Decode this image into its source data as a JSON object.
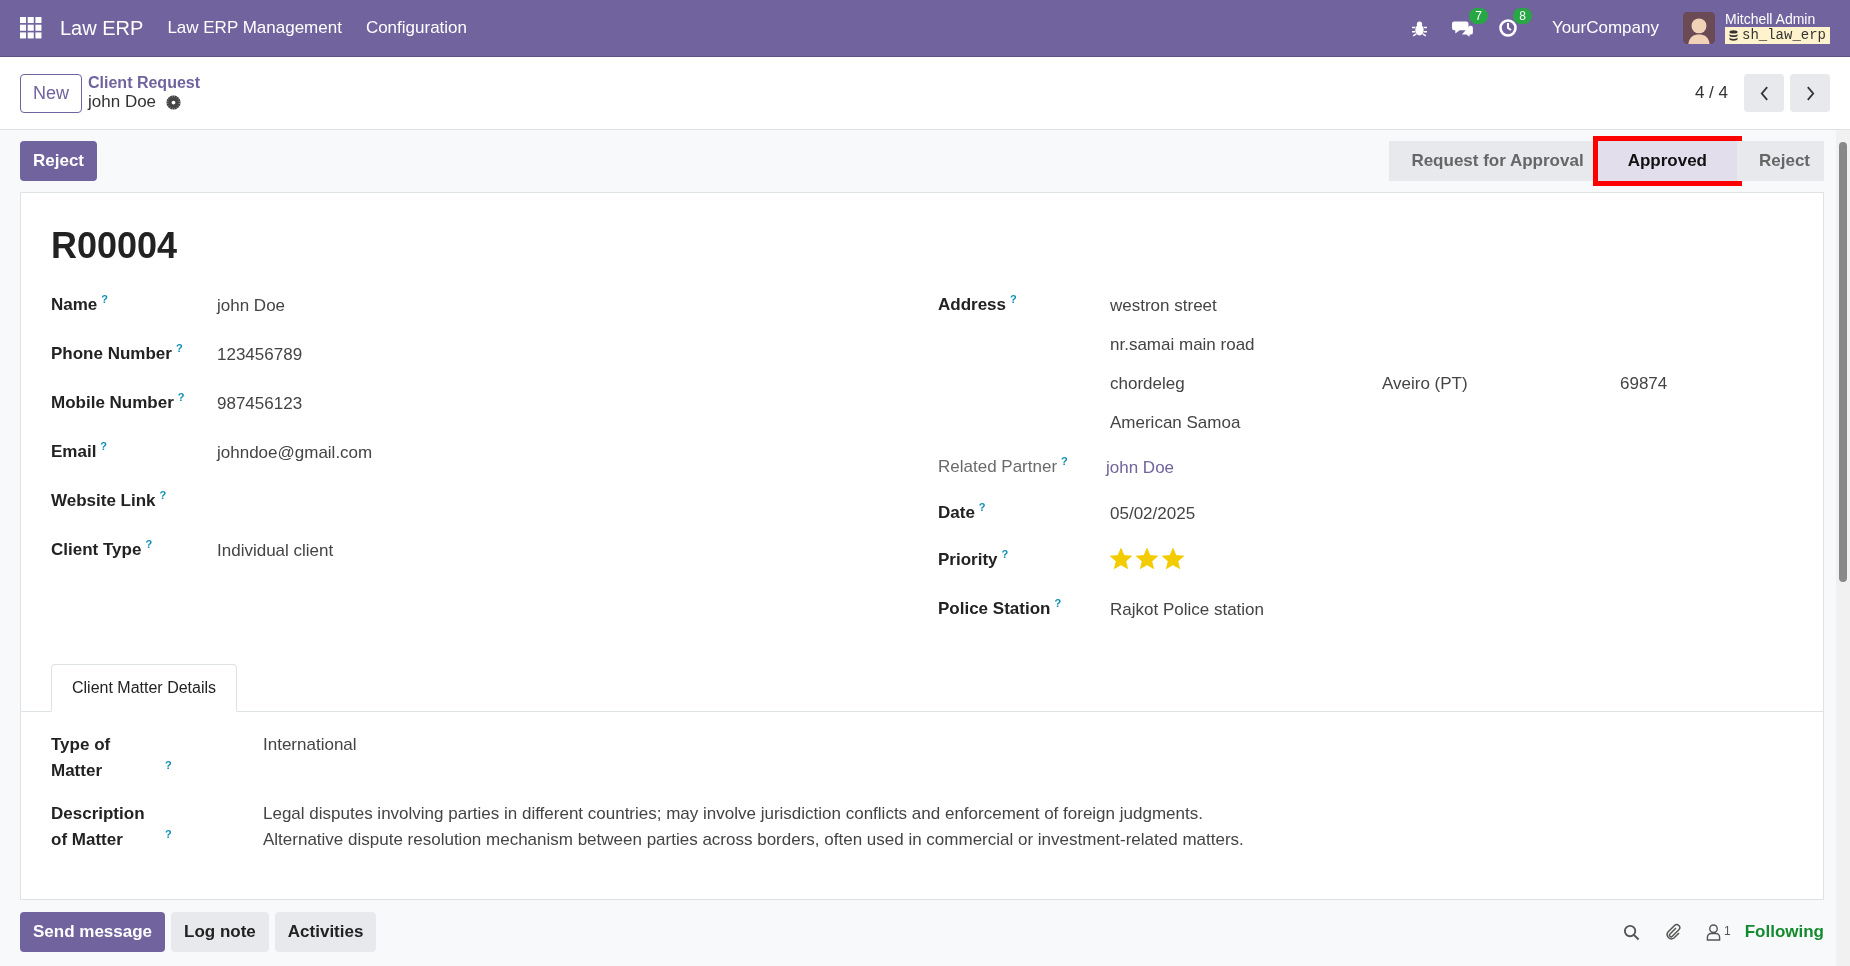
{
  "navbar": {
    "app_name": "Law ERP",
    "menus": [
      "Law ERP Management",
      "Configuration"
    ],
    "messages_count": "7",
    "activities_count": "8",
    "company": "YourCompany",
    "user": "Mitchell Admin",
    "database": "sh_law_erp"
  },
  "control_panel": {
    "new_button": "New",
    "breadcrumb": "Client Request",
    "record_name": "john Doe",
    "pager": "4 / 4"
  },
  "status_bar": {
    "action_button": "Reject",
    "stages": [
      {
        "label": "Request for Approval",
        "selected": false,
        "highlighted": false
      },
      {
        "label": "Approved",
        "selected": true,
        "highlighted": true
      },
      {
        "label": "Reject",
        "selected": false,
        "highlighted": false
      }
    ]
  },
  "sheet": {
    "reference": "R00004",
    "left_fields": [
      {
        "label": "Name",
        "help": "?",
        "value": "john Doe"
      },
      {
        "label": "Phone Number",
        "help": "?",
        "value": "123456789"
      },
      {
        "label": "Mobile Number",
        "help": "?",
        "value": "987456123"
      },
      {
        "label": "Email",
        "help": "?",
        "value": "johndoe@gmail.com"
      },
      {
        "label": "Website Link",
        "help": "?"
      },
      {
        "label": "Client Type",
        "help": "?",
        "value": "Individual client"
      }
    ],
    "address": {
      "label": "Address",
      "help": "?",
      "street": "westron street",
      "street2": "nr.samai main road",
      "city": "chordeleg",
      "state": "Aveiro (PT)",
      "zip": "69874",
      "country": "American Samoa"
    },
    "right_fields": [
      {
        "kind": "link",
        "label": "Related Partner",
        "help": "?",
        "value": "john Doe"
      },
      {
        "kind": "text",
        "label": "Date",
        "help": "?",
        "value": "05/02/2025"
      },
      {
        "kind": "stars",
        "label": "Priority",
        "help": "?",
        "stars": 3
      },
      {
        "kind": "text",
        "label": "Police Station",
        "help": "?",
        "value": "Rajkot Police station"
      }
    ],
    "tabs": [
      {
        "label": "Client Matter Details",
        "selected": true
      }
    ],
    "matter_fields": [
      {
        "label": "Type of Matter",
        "help": "?",
        "lines": [
          "International"
        ]
      },
      {
        "label": "Description of Matter",
        "help": "?",
        "lines": [
          "Legal disputes involving parties in different countries; may involve jurisdiction conflicts and enforcement of foreign judgments.",
          "Alternative dispute resolution mechanism between parties across borders, often used in commercial or investment-related matters."
        ]
      }
    ]
  },
  "chatter": {
    "buttons": [
      {
        "label": "Send message",
        "kind": "primary"
      },
      {
        "label": "Log note",
        "kind": "secondary"
      },
      {
        "label": "Activities",
        "kind": "secondary"
      }
    ],
    "followers_count": "1",
    "follow_status": "Following"
  }
}
